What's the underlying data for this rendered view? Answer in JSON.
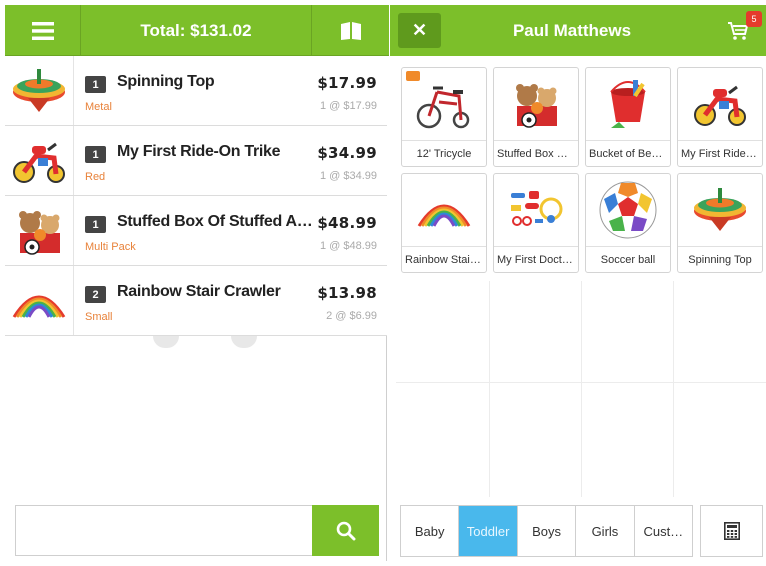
{
  "header": {
    "total": "Total: $131.02",
    "customer": "Paul Matthews",
    "cart_count": "5"
  },
  "cart_items": [
    {
      "qty": "1",
      "name": "Spinning Top",
      "variant": "Metal",
      "price": "$17.99",
      "each": "1 @ $17.99",
      "icon": "spinning-top"
    },
    {
      "qty": "1",
      "name": "My First Ride-On Trike",
      "variant": "Red",
      "price": "$34.99",
      "each": "1 @ $34.99",
      "icon": "trike"
    },
    {
      "qty": "1",
      "name": "Stuffed Box Of Stuffed Animals",
      "variant": "Multi Pack",
      "price": "$48.99",
      "each": "1 @ $48.99",
      "icon": "stuffed-animals"
    },
    {
      "qty": "2",
      "name": "Rainbow Stair Crawler",
      "variant": "Small",
      "price": "$13.98",
      "each": "2 @ $6.99",
      "icon": "slinky"
    }
  ],
  "search": {
    "placeholder": "",
    "value": ""
  },
  "products": [
    {
      "label": "12' Tricycle",
      "icon": "tricycle",
      "folder": true
    },
    {
      "label": "Stuffed Box Of Stuffed Animals",
      "icon": "stuffed-animals"
    },
    {
      "label": "Bucket of Beach Toys",
      "icon": "bucket"
    },
    {
      "label": "My First Ride-On Trike",
      "icon": "trike"
    },
    {
      "label": "Rainbow Stair Crawler",
      "icon": "slinky"
    },
    {
      "label": "My First Doctor Kit",
      "icon": "doctor-kit"
    },
    {
      "label": "Soccer ball",
      "icon": "soccer-ball"
    },
    {
      "label": "Spinning Top",
      "icon": "spinning-top"
    }
  ],
  "categories": [
    {
      "label": "Baby",
      "active": false
    },
    {
      "label": "Toddler",
      "active": true
    },
    {
      "label": "Boys",
      "active": false
    },
    {
      "label": "Girls",
      "active": false
    },
    {
      "label": "Cust…",
      "active": false
    }
  ],
  "colors": {
    "accent": "#7cbf2a",
    "active_tab": "#49b8ec",
    "variant": "#e8823a",
    "badge": "#e53b2c"
  }
}
